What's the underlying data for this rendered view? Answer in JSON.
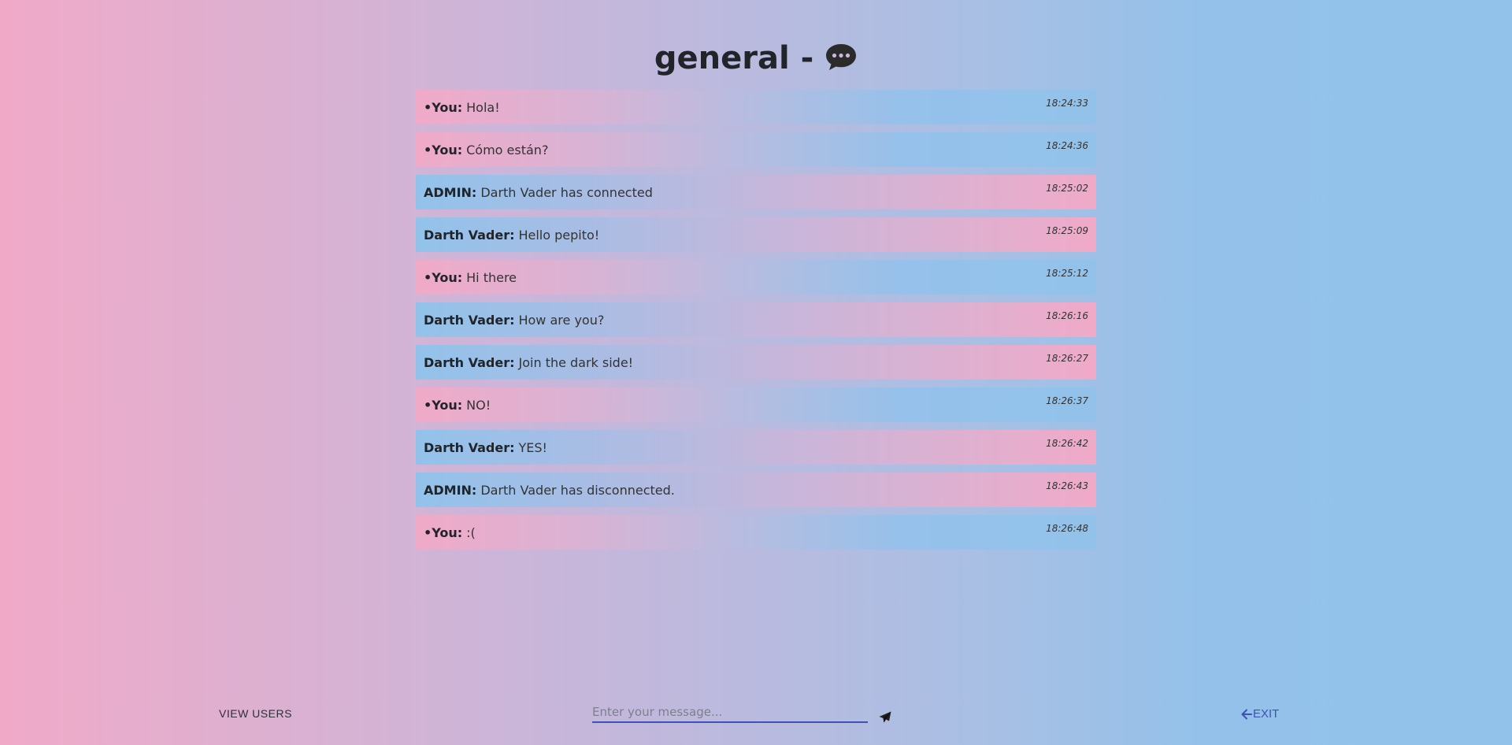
{
  "header": {
    "room_name": "general",
    "separator": "-",
    "icon": "speech-bubble-icon"
  },
  "messages": [
    {
      "author": "•You:",
      "text": "Hola!",
      "time": "18:24:33",
      "kind": "self"
    },
    {
      "author": "•You:",
      "text": "Cómo están?",
      "time": "18:24:36",
      "kind": "self"
    },
    {
      "author": "ADMIN:",
      "text": "Darth Vader has connected",
      "time": "18:25:02",
      "kind": "other"
    },
    {
      "author": "Darth Vader:",
      "text": "Hello pepito!",
      "time": "18:25:09",
      "kind": "other"
    },
    {
      "author": "•You:",
      "text": "Hi there",
      "time": "18:25:12",
      "kind": "self"
    },
    {
      "author": "Darth Vader:",
      "text": "How are you?",
      "time": "18:26:16",
      "kind": "other"
    },
    {
      "author": "Darth Vader:",
      "text": "Join the dark side!",
      "time": "18:26:27",
      "kind": "other"
    },
    {
      "author": "•You:",
      "text": "NO!",
      "time": "18:26:37",
      "kind": "self"
    },
    {
      "author": "Darth Vader:",
      "text": "YES!",
      "time": "18:26:42",
      "kind": "other"
    },
    {
      "author": "ADMIN:",
      "text": "Darth Vader has disconnected.",
      "time": "18:26:43",
      "kind": "other"
    },
    {
      "author": "•You:",
      "text": ":(",
      "time": "18:26:48",
      "kind": "self"
    }
  ],
  "footer": {
    "view_users_label": "VIEW USERS",
    "message_placeholder": "Enter your message...",
    "message_value": "",
    "send_icon": "paper-plane-icon",
    "exit_label": "EXIT",
    "exit_icon": "arrow-left-icon"
  },
  "colors": {
    "accent": "#3f51b5",
    "pink": "#f0aac8",
    "blue": "#92c2ea"
  }
}
